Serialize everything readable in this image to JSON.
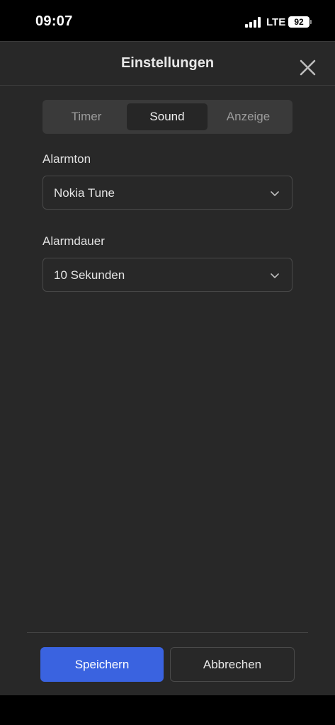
{
  "status_bar": {
    "time": "09:07",
    "network": "LTE",
    "battery": "92"
  },
  "header": {
    "title": "Einstellungen",
    "close_icon": "close-icon"
  },
  "tabs": [
    {
      "label": "Timer",
      "active": false
    },
    {
      "label": "Sound",
      "active": true
    },
    {
      "label": "Anzeige",
      "active": false
    }
  ],
  "alarm_tone": {
    "label": "Alarmton",
    "value": "Nokia Tune"
  },
  "alarm_duration": {
    "label": "Alarmdauer",
    "value": "10 Sekunden"
  },
  "footer": {
    "save_label": "Speichern",
    "cancel_label": "Abbrechen"
  },
  "colors": {
    "accent": "#3a63e0",
    "panel_bg": "#282828"
  }
}
